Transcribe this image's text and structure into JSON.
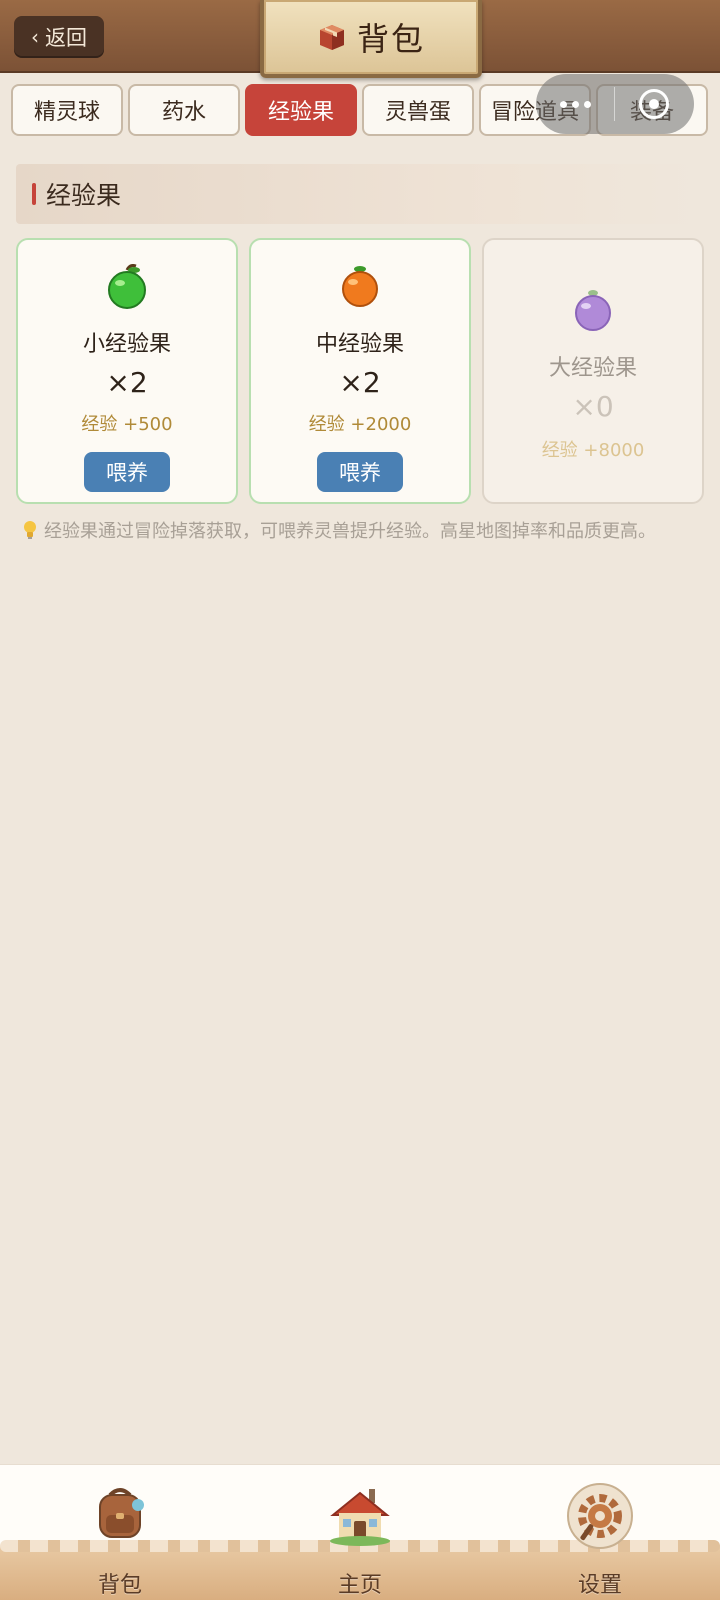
{
  "header": {
    "back_label": "返回",
    "title": "背包"
  },
  "tabs": [
    {
      "label": "精灵球",
      "active": false
    },
    {
      "label": "药水",
      "active": false
    },
    {
      "label": "经验果",
      "active": true
    },
    {
      "label": "灵兽蛋",
      "active": false
    },
    {
      "label": "冒险道具",
      "active": false
    },
    {
      "label": "装备",
      "active": false
    }
  ],
  "section": {
    "title": "经验果"
  },
  "items": [
    {
      "name": "小经验果",
      "count": "×2",
      "exp": "经验 +500",
      "button": "喂养",
      "icon": "green-apple-icon",
      "color": "#3fbf3a"
    },
    {
      "name": "中经验果",
      "count": "×2",
      "exp": "经验 +2000",
      "button": "喂养",
      "icon": "orange-fruit-icon",
      "color": "#f07a1e"
    },
    {
      "name": "大经验果",
      "count": "×0",
      "exp": "经验 +8000",
      "button": null,
      "icon": "purple-fruit-icon",
      "color": "#a77bd6"
    }
  ],
  "tip": "经验果通过冒险掉落获取，可喂养灵兽提升经验。高星地图掉率和品质更高。",
  "bottom_nav": [
    {
      "label": "背包",
      "icon": "backpack-icon"
    },
    {
      "label": "主页",
      "icon": "house-icon"
    },
    {
      "label": "设置",
      "icon": "gear-icon"
    }
  ],
  "colors": {
    "accent_red": "#c6443a",
    "feed_blue": "#4a80b4",
    "exp_gold": "#b08a38",
    "background": "#efe7dc"
  }
}
